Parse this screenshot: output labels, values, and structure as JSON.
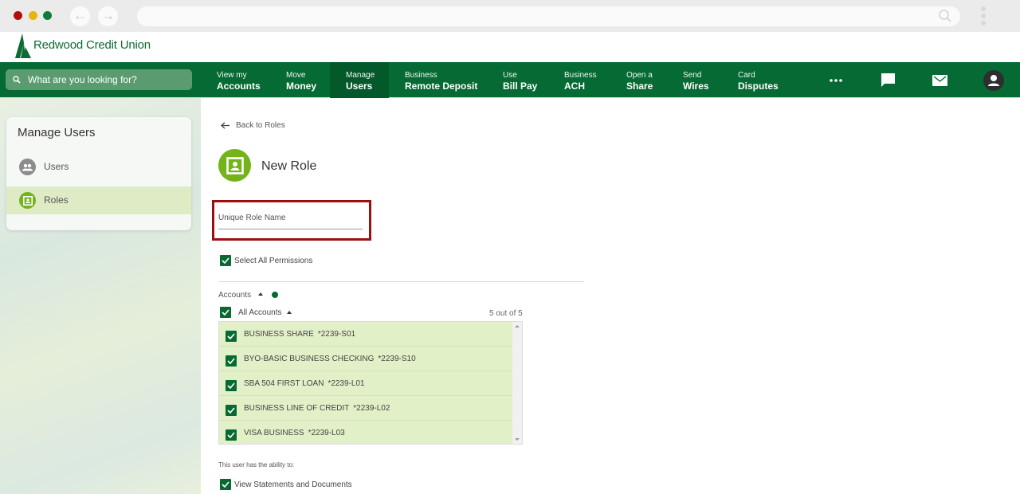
{
  "browser": {
    "back_icon": "arrow-left-icon",
    "forward_icon": "arrow-right-icon",
    "url": ""
  },
  "brand": {
    "name": "Redwood Credit Union"
  },
  "nav": {
    "search_placeholder": "What are you looking for?",
    "items": [
      {
        "small": "View my",
        "big": "Accounts"
      },
      {
        "small": "Move",
        "big": "Money"
      },
      {
        "small": "Manage",
        "big": "Users"
      },
      {
        "small": "Business",
        "big": "Remote Deposit"
      },
      {
        "small": "Use",
        "big": "Bill Pay"
      },
      {
        "small": "Business",
        "big": "ACH"
      },
      {
        "small": "Open a",
        "big": "Share"
      },
      {
        "small": "Send",
        "big": "Wires"
      },
      {
        "small": "Card",
        "big": "Disputes"
      }
    ],
    "active_index": 2,
    "icons": [
      "more-icon",
      "chat-icon",
      "mail-icon",
      "account-icon"
    ]
  },
  "sidebar": {
    "title": "Manage Users",
    "items": [
      {
        "label": "Users",
        "icon": "users-icon"
      },
      {
        "label": "Roles",
        "icon": "role-icon",
        "selected": true
      }
    ]
  },
  "content": {
    "back_label": "Back to Roles",
    "title": "New Role",
    "role_name_label": "Unique Role Name",
    "role_name_value": "",
    "select_all_label": "Select All Permissions",
    "accounts_label": "Accounts",
    "all_accounts_label": "All Accounts",
    "count_label": "5 out of 5",
    "accounts": [
      {
        "name": "BUSINESS SHARE",
        "number": "*2239-S01",
        "checked": true
      },
      {
        "name": "BYO-BASIC BUSINESS CHECKING",
        "number": "*2239-S10",
        "checked": true
      },
      {
        "name": "SBA 504 FIRST LOAN",
        "number": "*2239-L01",
        "checked": true
      },
      {
        "name": "BUSINESS LINE OF CREDIT",
        "number": "*2239-L02",
        "checked": true
      },
      {
        "name": "VISA BUSINESS",
        "number": "*2239-L03",
        "checked": true
      }
    ],
    "ability_label": "This user has the ability to:",
    "permissions": [
      {
        "label": "View Statements and Documents",
        "checked": true
      }
    ]
  },
  "colors": {
    "brand_green": "#056a33",
    "accent_lime": "#74b31a",
    "highlight_red": "#9c0f0f",
    "selected_row": "#deebc5"
  }
}
